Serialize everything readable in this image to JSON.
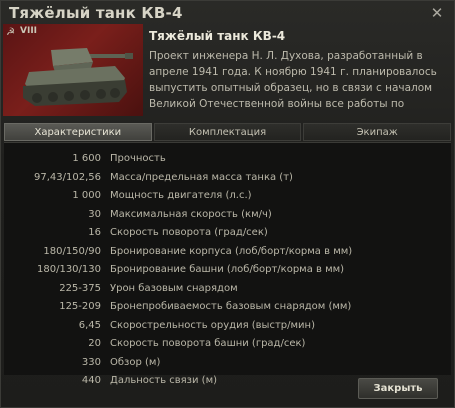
{
  "window": {
    "title": "Тяжёлый танк КВ-4"
  },
  "tank": {
    "tier": "VIII",
    "name": "Тяжёлый танк КВ-4",
    "description": "Проект инженера Н. Л. Духова, разработанный в апреле 1941 года. К ноябрю 1941 г. планировалось выпустить опытный образец, но в связи с началом Великой Отечественной войны все работы по созданию машины"
  },
  "tabs": [
    {
      "label": "Характеристики",
      "active": true
    },
    {
      "label": "Комплектация",
      "active": false
    },
    {
      "label": "Экипаж",
      "active": false
    }
  ],
  "stats": [
    {
      "value": "1 600",
      "label": "Прочность"
    },
    {
      "value": "97,43/102,56",
      "label": "Масса/предельная масса танка (т)"
    },
    {
      "value": "1 000",
      "label": "Мощность двигателя (л.с.)"
    },
    {
      "value": "30",
      "label": "Максимальная скорость (км/ч)"
    },
    {
      "value": "16",
      "label": "Скорость поворота (град/сек)"
    },
    {
      "value": "180/150/90",
      "label": "Бронирование корпуса (лоб/борт/корма в мм)"
    },
    {
      "value": "180/130/130",
      "label": "Бронирование башни (лоб/борт/корма в мм)"
    },
    {
      "value": "225-375",
      "label": "Урон базовым снарядом"
    },
    {
      "value": "125-209",
      "label": "Бронепробиваемость базовым снарядом (мм)"
    },
    {
      "value": "6,45",
      "label": "Скорострельность орудия (выстр/мин)"
    },
    {
      "value": "20",
      "label": "Скорость поворота башни (град/сек)"
    },
    {
      "value": "330",
      "label": "Обзор (м)"
    },
    {
      "value": "440",
      "label": "Дальность связи (м)"
    }
  ],
  "footer": {
    "close_label": "Закрыть"
  },
  "icons": {
    "close": "close-icon",
    "nation": "hammer-sickle-icon"
  },
  "colors": {
    "accent_bg": "#7a1f1b",
    "panel": "#121211"
  }
}
